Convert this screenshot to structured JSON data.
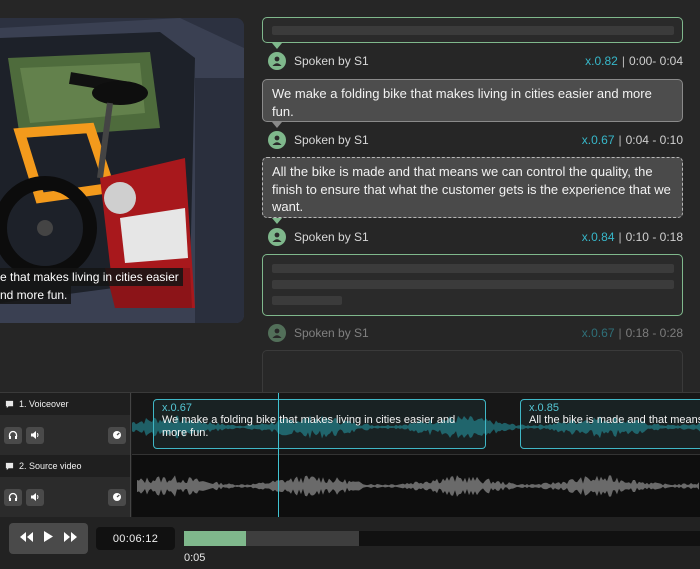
{
  "video": {
    "subtitle_lines": [
      "e that makes living in cities easier",
      "nd more fun."
    ]
  },
  "transcript": {
    "segments": [
      {
        "speaker": "Spoken by S1",
        "speed": "x.0.82",
        "sep": "|",
        "time": "0:00- 0:04",
        "text": "We make a folding bike that makes living in cities easier and more fun."
      },
      {
        "speaker": "Spoken by S1",
        "speed": "x.0.67",
        "sep": "|",
        "time": "0:04 - 0:10",
        "text": "All the bike is made and that means we can control the quality, the finish to ensure that what the customer gets is the experience that we want."
      },
      {
        "speaker": "Spoken by S1",
        "speed": "x.0.84",
        "sep": "|",
        "time": "0:10 - 0:18"
      },
      {
        "speaker": "Spoken by S1",
        "speed": "x.0.67",
        "sep": "|",
        "time": "0:18 - 0:28"
      }
    ]
  },
  "timeline": {
    "tracks": [
      {
        "label": "1.  Voiceover",
        "icon": "comment-icon"
      },
      {
        "label": "2.  Source video",
        "icon": "comment-icon"
      }
    ],
    "clips": [
      {
        "speed": "x.0.67",
        "text": "We make a folding bike that makes living in cities easier and more fun."
      },
      {
        "speed": "x.0.85",
        "text": "All the bike is made and that means we can control the quality, that what the customer gets is the experience"
      }
    ]
  },
  "transport": {
    "timecode": "00:06:12",
    "progress_label": "0:05",
    "progress_fraction": 0.12,
    "buffer_fraction": 0.34
  },
  "colors": {
    "accent_green": "#7fb88c",
    "accent_cyan": "#37b7c9"
  }
}
